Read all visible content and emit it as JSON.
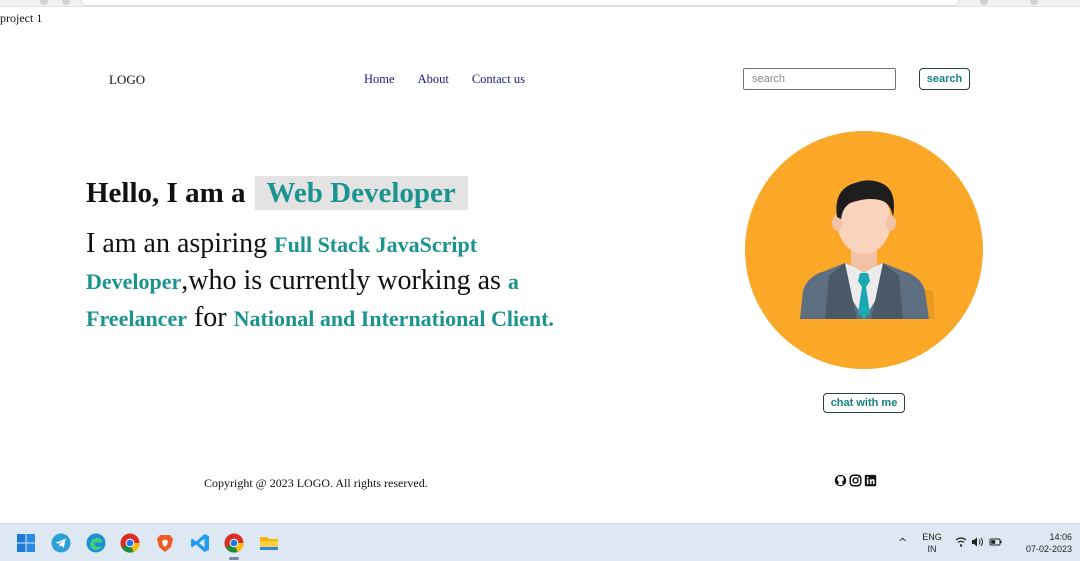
{
  "page_label": "project 1",
  "header": {
    "logo": "LOGO",
    "nav": [
      {
        "label": "Home"
      },
      {
        "label": "About"
      },
      {
        "label": "Contact us"
      }
    ],
    "search": {
      "placeholder": "search",
      "button_label": "search"
    }
  },
  "hero": {
    "heading_prefix": "Hello, I am a",
    "heading_highlight": "Web Developer",
    "text_parts": [
      {
        "text": "I am an aspiring ",
        "accent": false
      },
      {
        "text": "Full Stack JavaScript Developer",
        "accent": true
      },
      {
        "text": ",who is currently working as ",
        "accent": false
      },
      {
        "text": "a Freelancer",
        "accent": true
      },
      {
        "text": " for ",
        "accent": false
      },
      {
        "text": "National and International Client",
        "accent": true
      },
      {
        "text": ".",
        "accent": false
      }
    ]
  },
  "avatar": {
    "icon": "user-avatar-icon",
    "bg_color": "#fba728"
  },
  "chat_button_label": "chat with me",
  "footer": {
    "copyright": "Copyright @ 2023 LOGO. All rights reserved.",
    "social_icons": [
      "github-icon",
      "instagram-icon",
      "linkedin-icon"
    ]
  },
  "colors": {
    "accent": "#1b948f",
    "nav_link": "#1a1a8c"
  },
  "taskbar": {
    "apps": [
      "windows-start-icon",
      "telegram-icon",
      "edge-icon",
      "chrome-icon",
      "brave-icon",
      "vscode-icon",
      "chrome-icon",
      "file-explorer-icon"
    ],
    "language_top": "ENG",
    "language_bottom": "IN",
    "time": "14:06",
    "date": "07-02-2023"
  }
}
